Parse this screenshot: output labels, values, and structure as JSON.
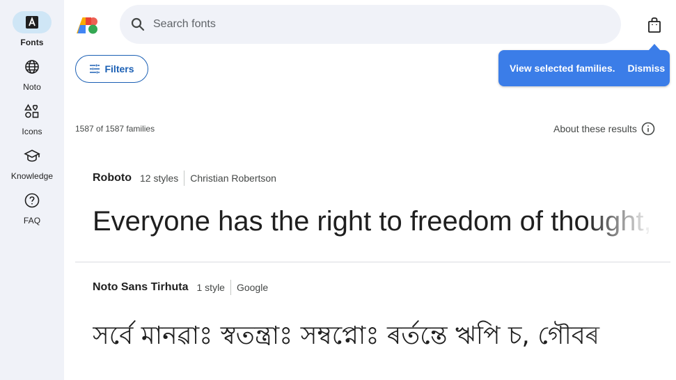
{
  "sidebar": {
    "items": [
      {
        "label": "Fonts",
        "icon": "font-icon",
        "active": true
      },
      {
        "label": "Noto",
        "icon": "globe-icon",
        "active": false
      },
      {
        "label": "Icons",
        "icon": "shapes-icon",
        "active": false
      },
      {
        "label": "Knowledge",
        "icon": "school-icon",
        "active": false
      },
      {
        "label": "FAQ",
        "icon": "help-icon",
        "active": false
      }
    ]
  },
  "header": {
    "search_placeholder": "Search fonts",
    "bag_icon": "shopping-bag-icon"
  },
  "tooltip": {
    "text": "View selected families.",
    "dismiss": "Dismiss"
  },
  "toolbar": {
    "filters_label": "Filters"
  },
  "results": {
    "count_text": "1587 of 1587 families",
    "about_label": "About these results"
  },
  "fonts": [
    {
      "name": "Roboto",
      "styles": "12 styles",
      "designer": "Christian Robertson",
      "sample": "Everyone has the right to freedom of thought,"
    },
    {
      "name": "Noto Sans Tirhuta",
      "styles": "1 style",
      "designer": "Google",
      "sample": "সর্বে মানৱাঃ স্বতন্ত্রাঃ সম্বপ্নোঃ ৰর্তন্তে ঋপি চ, গৌবৰ"
    }
  ],
  "colors": {
    "accent": "#1a5fb4",
    "tooltip_bg": "#3b7de8",
    "sidebar_bg": "#f0f2f8",
    "active_pill": "#cfe6f6"
  }
}
